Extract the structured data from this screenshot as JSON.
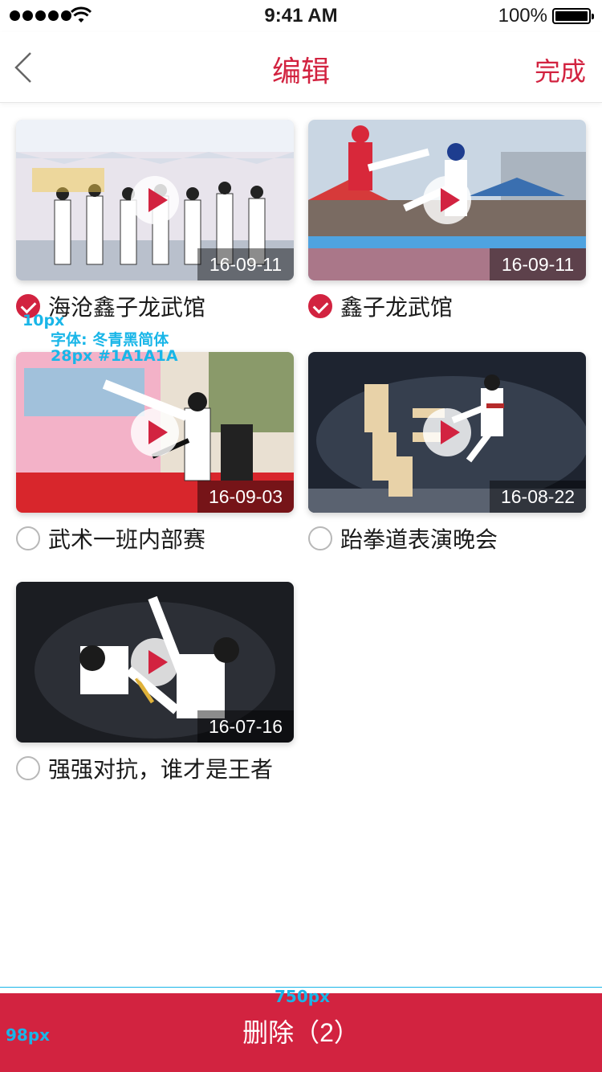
{
  "status_bar": {
    "time": "9:41 AM",
    "battery": "100%"
  },
  "nav": {
    "title": "编辑",
    "done": "完成"
  },
  "videos": [
    {
      "title": "海沧鑫子龙武馆",
      "date": "16-09-11",
      "checked": true
    },
    {
      "title": "鑫子龙武馆",
      "date": "16-09-11",
      "checked": true
    },
    {
      "title": "武术一班内部赛",
      "date": "16-09-03",
      "checked": false
    },
    {
      "title": "跆拳道表演晚会",
      "date": "16-08-22",
      "checked": false
    },
    {
      "title": "强强对抗，谁才是王者",
      "date": "16-07-16",
      "checked": false
    }
  ],
  "annotations": {
    "spacing": "10px",
    "font_note": "字体: 冬青黑简体",
    "size_note": "28px #1A1A1A",
    "width_note": "750px",
    "height_note": "98px"
  },
  "delete_label": "删除（2）",
  "colors": {
    "accent": "#D22340",
    "text": "#1A1A1A",
    "annotation": "#19B6E8"
  }
}
